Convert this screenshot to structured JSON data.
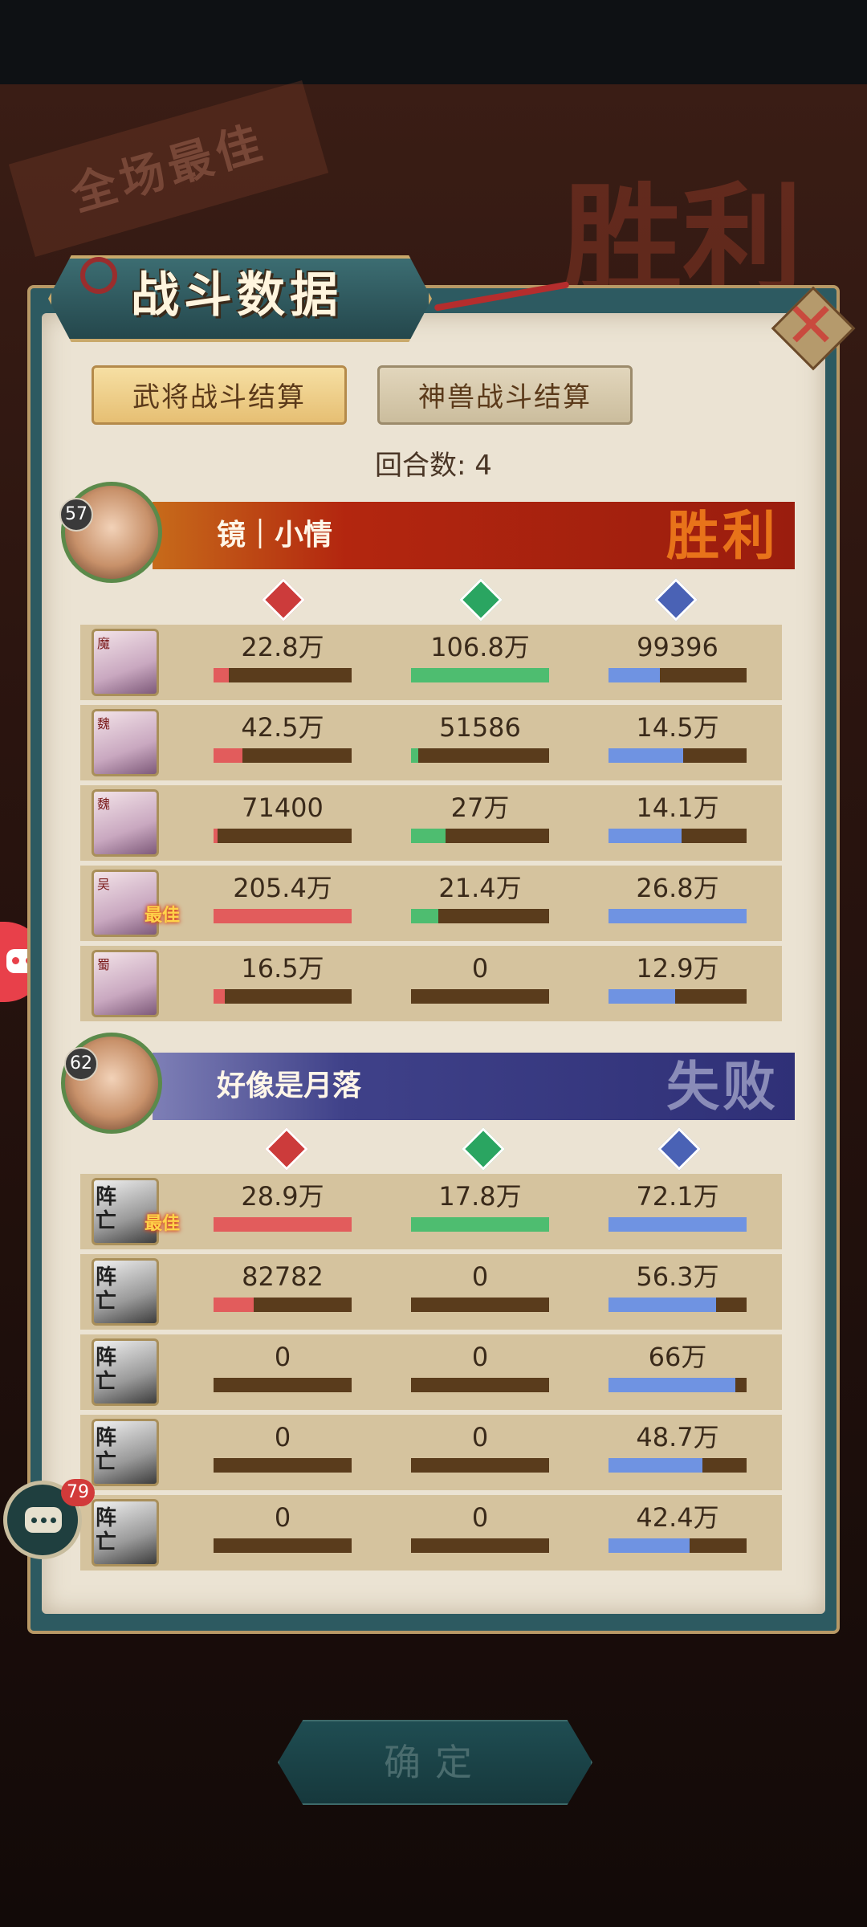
{
  "header": {
    "title": "战斗数据",
    "close_icon": "close-icon"
  },
  "background": {
    "best_text": "全场最佳",
    "victory_text": "胜利"
  },
  "tabs": [
    {
      "label": "武将战斗结算",
      "active": true
    },
    {
      "label": "神兽战斗结算",
      "active": false
    }
  ],
  "round": "回合数: 4",
  "stat_icons": [
    "damage-icon",
    "heal-icon",
    "defense-icon"
  ],
  "teams": [
    {
      "player_name": "镜｜小情",
      "level": "57",
      "result": "胜利",
      "result_color": "#e8731a",
      "rows": [
        {
          "portrait_tag": "魔",
          "damage": "22.8万",
          "heal": "106.8万",
          "defense": "99396",
          "damage_pct": 0.11,
          "heal_pct": 1.0,
          "defense_pct": 0.37,
          "mvp": ""
        },
        {
          "portrait_tag": "魏",
          "damage": "42.5万",
          "heal": "51586",
          "defense": "14.5万",
          "damage_pct": 0.21,
          "heal_pct": 0.05,
          "defense_pct": 0.54,
          "mvp": ""
        },
        {
          "portrait_tag": "魏",
          "damage": "71400",
          "heal": "27万",
          "defense": "14.1万",
          "damage_pct": 0.03,
          "heal_pct": 0.25,
          "defense_pct": 0.53,
          "mvp": ""
        },
        {
          "portrait_tag": "吴",
          "damage": "205.4万",
          "heal": "21.4万",
          "defense": "26.8万",
          "damage_pct": 1.0,
          "heal_pct": 0.2,
          "defense_pct": 1.0,
          "mvp": "最佳"
        },
        {
          "portrait_tag": "蜀",
          "damage": "16.5万",
          "heal": "0",
          "defense": "12.9万",
          "damage_pct": 0.08,
          "heal_pct": 0.0,
          "defense_pct": 0.48,
          "mvp": ""
        }
      ]
    },
    {
      "player_name": "好像是月落",
      "level": "62",
      "result": "失败",
      "result_color": "#8a8cb8",
      "rows": [
        {
          "portrait_tag": "阵亡",
          "damage": "28.9万",
          "heal": "17.8万",
          "defense": "72.1万",
          "damage_pct": 1.0,
          "heal_pct": 1.0,
          "defense_pct": 1.0,
          "mvp": "最佳"
        },
        {
          "portrait_tag": "阵亡",
          "damage": "82782",
          "heal": "0",
          "defense": "56.3万",
          "damage_pct": 0.29,
          "heal_pct": 0.0,
          "defense_pct": 0.78,
          "mvp": ""
        },
        {
          "portrait_tag": "阵亡",
          "damage": "0",
          "heal": "0",
          "defense": "66万",
          "damage_pct": 0.0,
          "heal_pct": 0.0,
          "defense_pct": 0.92,
          "mvp": ""
        },
        {
          "portrait_tag": "阵亡",
          "damage": "0",
          "heal": "0",
          "defense": "48.7万",
          "damage_pct": 0.0,
          "heal_pct": 0.0,
          "defense_pct": 0.68,
          "mvp": ""
        },
        {
          "portrait_tag": "阵亡",
          "damage": "0",
          "heal": "0",
          "defense": "42.4万",
          "damage_pct": 0.0,
          "heal_pct": 0.0,
          "defense_pct": 0.59,
          "mvp": ""
        }
      ]
    }
  ],
  "chat": {
    "badge": "79"
  },
  "confirm_label": "确定"
}
